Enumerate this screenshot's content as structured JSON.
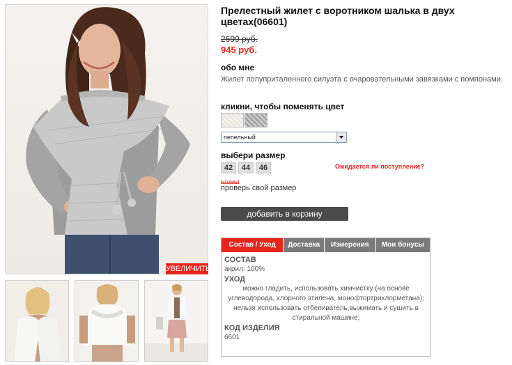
{
  "product": {
    "title": "Прелестный жилет с воротником шалька в двух цветах(06601)",
    "old_price": "2699 руб.",
    "new_price": "945 руб."
  },
  "gallery": {
    "zoom_label": "УВЕЛИЧИТЬ"
  },
  "about": {
    "heading": "обо мне",
    "text": "Жилет полуприталенного силуэта с очаровательными завязками с помпонами."
  },
  "color": {
    "heading": "кликни, чтобы поменять цвет",
    "selected": "пепельный"
  },
  "size": {
    "heading": "выбери размер",
    "options": [
      "42",
      "44",
      "46"
    ],
    "arrival_link": "Ожидается ли поступление?",
    "check_link": "проверь свой размер"
  },
  "cart": {
    "label": "добавить в корзину"
  },
  "tabs": {
    "items": [
      "Состав / Уход",
      "Доставка",
      "Измерения",
      "Мои бонусы"
    ],
    "content": {
      "composition_h": "СОСТАВ",
      "composition": "акрил: 100%",
      "care_h": "УХОД",
      "care": "можно гладить, использовать химчистку (на основе углеводорода, хлорного этилена, монофтортрихлорметана); нельзя использовать отбеливатель,выжимать и сушить в стиральной машине;",
      "code_h": "КОД ИЗДЕЛИЯ",
      "code": "6601"
    }
  },
  "colors": {
    "accent": "#e8251d",
    "button": "#4a4a4a",
    "tab_inactive": "#7a7a7a"
  }
}
